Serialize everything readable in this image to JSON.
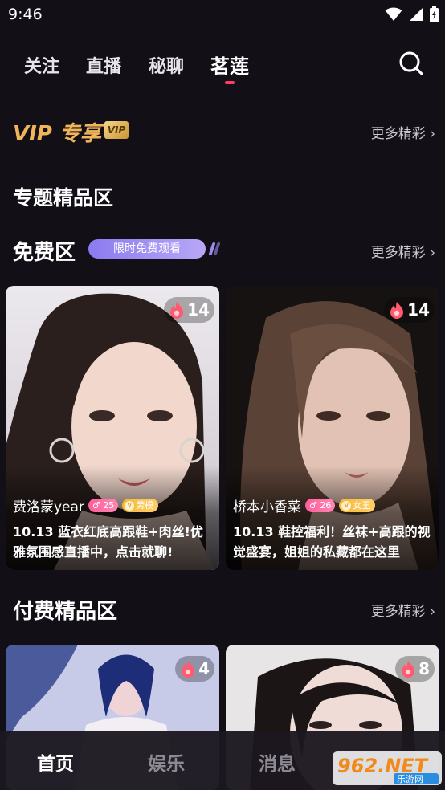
{
  "status": {
    "time": "9:46"
  },
  "nav": {
    "tabs": [
      {
        "label": "关注"
      },
      {
        "label": "直播"
      },
      {
        "label": "秘聊"
      },
      {
        "label": "茗莲"
      }
    ],
    "active_index": 3
  },
  "vip": {
    "title": "VIP 专享",
    "badge": "VIP",
    "more": "更多精彩 ›"
  },
  "topics": {
    "title": "专题精品区"
  },
  "free": {
    "title": "免费区",
    "pill": "限时免费观看",
    "more": "更多精彩 ›",
    "cards": [
      {
        "hot": "14",
        "name": "费洛蒙year",
        "level": "25",
        "role": "劳模",
        "desc": "10.13 蓝衣红底高跟鞋+肉丝!优雅氛围感直播中，点击就聊!"
      },
      {
        "hot": "14",
        "name": "桥本小香菜",
        "level": "26",
        "role": "女王",
        "desc": "10.13 鞋控福利！丝袜+高跟的视觉盛宴，姐姐的私藏都在这里"
      }
    ]
  },
  "paid": {
    "title": "付费精品区",
    "more": "更多精彩 ›",
    "cards": [
      {
        "hot": "4"
      },
      {
        "hot": "8"
      }
    ]
  },
  "bottom_nav": {
    "items": [
      {
        "label": "首页"
      },
      {
        "label": "娱乐"
      },
      {
        "label": "消息"
      }
    ],
    "active_index": 0
  },
  "watermark": {
    "text": "962.NET",
    "sub": "乐游网"
  },
  "colors": {
    "accent": "#ff3d6b",
    "vip_gold": "#f0b45a",
    "pill": "#8a7bf0",
    "background": "#120f16"
  }
}
